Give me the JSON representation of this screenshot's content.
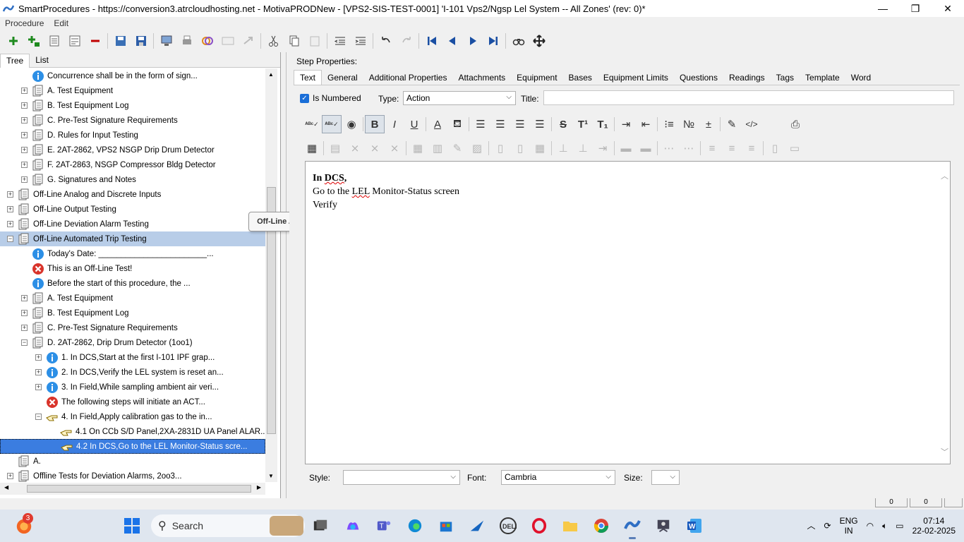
{
  "window": {
    "title": "SmartProcedures - https://conversion3.atrcloudhosting.net - MotivaPRODNew - [VPS2-SIS-TEST-0001] 'I-101 Vps2/Ngsp Lel System -- All Zones' (rev: 0)*",
    "minimize": "—",
    "maximize": "❐",
    "close": "✕"
  },
  "menu": {
    "items": [
      "Procedure",
      "Edit"
    ]
  },
  "left_tabs": [
    "Tree",
    "List"
  ],
  "tree": {
    "rows": [
      {
        "label": "Concurrence shall be in the form of sign...",
        "indent": 1,
        "icon": "info",
        "exp": "none"
      },
      {
        "label": "A. Test Equipment",
        "indent": 1,
        "icon": "doc",
        "exp": "plus"
      },
      {
        "label": "B. Test Equipment Log",
        "indent": 1,
        "icon": "doc",
        "exp": "plus"
      },
      {
        "label": "C. Pre-Test Signature Requirements",
        "indent": 1,
        "icon": "doc",
        "exp": "plus"
      },
      {
        "label": "D. Rules for Input Testing",
        "indent": 1,
        "icon": "doc",
        "exp": "plus"
      },
      {
        "label": "E. 2AT-2862, VPS2 NSGP Drip Drum Detector",
        "indent": 1,
        "icon": "doc",
        "exp": "plus"
      },
      {
        "label": "F. 2AT-2863, NSGP Compressor Bldg Detector",
        "indent": 1,
        "icon": "doc",
        "exp": "plus"
      },
      {
        "label": "G. Signatures and Notes",
        "indent": 1,
        "icon": "doc",
        "exp": "plus"
      },
      {
        "label": "Off-Line Analog and Discrete Inputs",
        "indent": 0,
        "icon": "doc",
        "exp": "plus"
      },
      {
        "label": "Off-Line Output Testing",
        "indent": 0,
        "icon": "doc",
        "exp": "plus"
      },
      {
        "label": "Off-Line Deviation Alarm Testing",
        "indent": 0,
        "icon": "doc",
        "exp": "plus"
      },
      {
        "label": "Off-Line Automated Trip Testing",
        "indent": 0,
        "icon": "doc",
        "exp": "minus",
        "sel": "gray"
      },
      {
        "label": "Today's Date: ________________________...",
        "indent": 1,
        "icon": "info",
        "exp": "none"
      },
      {
        "label": "This is an Off-Line Test!",
        "indent": 1,
        "icon": "error",
        "exp": "none"
      },
      {
        "label": "Before the start of this procedure, the ...",
        "indent": 1,
        "icon": "info",
        "exp": "none"
      },
      {
        "label": "A. Test Equipment",
        "indent": 1,
        "icon": "doc",
        "exp": "plus"
      },
      {
        "label": "B. Test Equipment Log",
        "indent": 1,
        "icon": "doc",
        "exp": "plus"
      },
      {
        "label": "C. Pre-Test Signature Requirements",
        "indent": 1,
        "icon": "doc",
        "exp": "plus"
      },
      {
        "label": "D. 2AT-2862, Drip Drum Detector (1oo1)",
        "indent": 1,
        "icon": "doc",
        "exp": "minus"
      },
      {
        "label": "1. In DCS,Start at the first I-101 IPF grap...",
        "indent": 2,
        "icon": "info",
        "exp": "plus"
      },
      {
        "label": "2. In DCS,Verify the LEL system is reset an...",
        "indent": 2,
        "icon": "info",
        "exp": "plus"
      },
      {
        "label": "3. In Field,While sampling ambient air veri...",
        "indent": 2,
        "icon": "info",
        "exp": "plus"
      },
      {
        "label": "The following steps will initiate an ACT...",
        "indent": 2,
        "icon": "error",
        "exp": "none"
      },
      {
        "label": "4. In Field,Apply calibration gas to the in...",
        "indent": 2,
        "icon": "hand",
        "exp": "minus"
      },
      {
        "label": "4.1 On CCb S/D Panel,2XA-2831D UA Panel ALAR...",
        "indent": 3,
        "icon": "hand",
        "exp": "none"
      },
      {
        "label": "4.2 In DCS,Go to the LEL Monitor-Status scre...",
        "indent": 3,
        "icon": "hand",
        "exp": "none",
        "sel": "blue"
      },
      {
        "label": "A.",
        "indent": 0,
        "icon": "doc",
        "exp": "none"
      },
      {
        "label": "Offline Tests for Deviation Alarms, 2oo3...",
        "indent": 0,
        "icon": "doc",
        "exp": "plus"
      }
    ]
  },
  "tooltip": "Off-Line Automated Trip Testing",
  "step": {
    "label": "Step Properties:",
    "tabs": [
      "Text",
      "General",
      "Additional Properties",
      "Attachments",
      "Equipment",
      "Bases",
      "Equipment Limits",
      "Questions",
      "Readings",
      "Tags",
      "Template",
      "Word"
    ],
    "is_numbered_label": "Is Numbered",
    "type_label": "Type:",
    "type_value": "Action",
    "title_label": "Title:",
    "title_value": ""
  },
  "editor": {
    "line1_a": "In ",
    "line1_b": "DCS",
    "line1_c": ",",
    "line2_a": "Go to the ",
    "line2_b": "LEL",
    "line2_c": " Monitor-Status screen",
    "line3": "Verify"
  },
  "stylebar": {
    "style_label": "Style:",
    "style_value": "",
    "font_label": "Font:",
    "font_value": "Cambria",
    "size_label": "Size:",
    "size_value": ""
  },
  "status": {
    "cell1": "0",
    "cell2": "0"
  },
  "taskbar": {
    "search_label": "Search",
    "badge": "3",
    "lang_top": "ENG",
    "lang_bottom": "IN",
    "time": "07:14",
    "date": "22-02-2025"
  }
}
